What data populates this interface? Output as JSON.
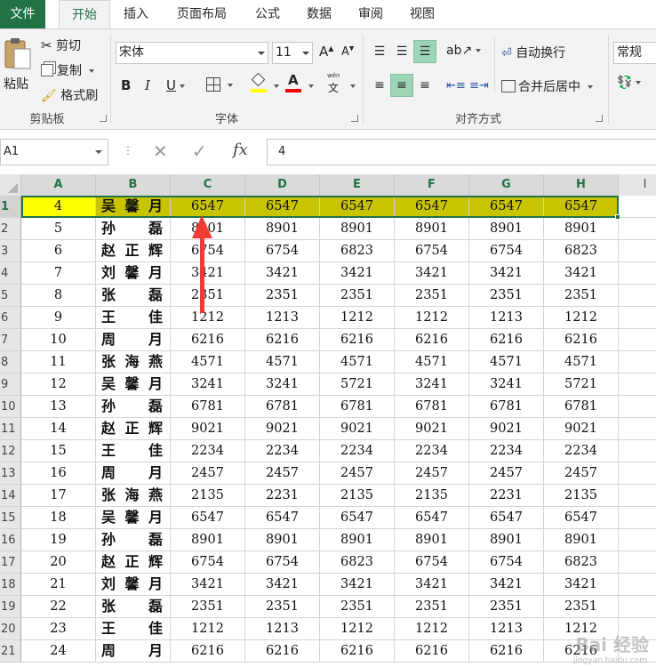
{
  "tabs": [
    "文件",
    "开始",
    "插入",
    "页面布局",
    "公式",
    "数据",
    "审阅",
    "视图"
  ],
  "clipboard": {
    "paste": "粘贴",
    "cut": "剪切",
    "copy": "复制",
    "format_painter": "格式刷",
    "group": "剪贴板"
  },
  "font": {
    "name": "宋体",
    "size": "11",
    "bold": "B",
    "italic": "I",
    "underline": "U",
    "group": "字体",
    "wen": "wén",
    "wen_char": "文",
    "fill_color": "#ffff00",
    "font_color": "#ff0000"
  },
  "alignment": {
    "wrap_text": "自动换行",
    "merge_center": "合并后居中",
    "group": "对齐方式"
  },
  "number": {
    "format": "常规"
  },
  "formula_bar": {
    "name_box": "A1",
    "fx": "fx",
    "value": "4"
  },
  "columns": [
    "A",
    "B",
    "C",
    "D",
    "E",
    "F",
    "G",
    "H",
    "I"
  ],
  "rows": [
    [
      "1",
      "4",
      "吴馨月",
      "6547",
      "6547",
      "6547",
      "6547",
      "6547",
      "6547"
    ],
    [
      "2",
      "5",
      "孙　磊",
      "8901",
      "8901",
      "8901",
      "8901",
      "8901",
      "8901"
    ],
    [
      "3",
      "6",
      "赵正辉",
      "6754",
      "6754",
      "6823",
      "6754",
      "6754",
      "6823"
    ],
    [
      "4",
      "7",
      "刘馨月",
      "3421",
      "3421",
      "3421",
      "3421",
      "3421",
      "3421"
    ],
    [
      "5",
      "8",
      "张　磊",
      "2351",
      "2351",
      "2351",
      "2351",
      "2351",
      "2351"
    ],
    [
      "6",
      "9",
      "王　佳",
      "1212",
      "1213",
      "1212",
      "1212",
      "1213",
      "1212"
    ],
    [
      "7",
      "10",
      "周　月",
      "6216",
      "6216",
      "6216",
      "6216",
      "6216",
      "6216"
    ],
    [
      "8",
      "11",
      "张海燕",
      "4571",
      "4571",
      "4571",
      "4571",
      "4571",
      "4571"
    ],
    [
      "9",
      "12",
      "吴馨月",
      "3241",
      "3241",
      "5721",
      "3241",
      "3241",
      "5721"
    ],
    [
      "10",
      "13",
      "孙　磊",
      "6781",
      "6781",
      "6781",
      "6781",
      "6781",
      "6781"
    ],
    [
      "11",
      "14",
      "赵正辉",
      "9021",
      "9021",
      "9021",
      "9021",
      "9021",
      "9021"
    ],
    [
      "12",
      "15",
      "王　佳",
      "2234",
      "2234",
      "2234",
      "2234",
      "2234",
      "2234"
    ],
    [
      "13",
      "16",
      "周　月",
      "2457",
      "2457",
      "2457",
      "2457",
      "2457",
      "2457"
    ],
    [
      "14",
      "17",
      "张海燕",
      "2135",
      "2231",
      "2135",
      "2135",
      "2231",
      "2135"
    ],
    [
      "15",
      "18",
      "吴馨月",
      "6547",
      "6547",
      "6547",
      "6547",
      "6547",
      "6547"
    ],
    [
      "16",
      "19",
      "孙　磊",
      "8901",
      "8901",
      "8901",
      "8901",
      "8901",
      "8901"
    ],
    [
      "17",
      "20",
      "赵正辉",
      "6754",
      "6754",
      "6823",
      "6754",
      "6754",
      "6823"
    ],
    [
      "18",
      "21",
      "刘馨月",
      "3421",
      "3421",
      "3421",
      "3421",
      "3421",
      "3421"
    ],
    [
      "19",
      "22",
      "张　磊",
      "2351",
      "2351",
      "2351",
      "2351",
      "2351",
      "2351"
    ],
    [
      "20",
      "23",
      "王　佳",
      "1212",
      "1213",
      "1212",
      "1212",
      "1213",
      "1212"
    ],
    [
      "21",
      "24",
      "周　月",
      "6216",
      "6216",
      "6216",
      "6216",
      "6216",
      "6216"
    ]
  ],
  "selected_row": "1",
  "watermark": "Bai 经验",
  "watermark_sub": "jingyan.baidu.com",
  "accent_color": "#217346"
}
